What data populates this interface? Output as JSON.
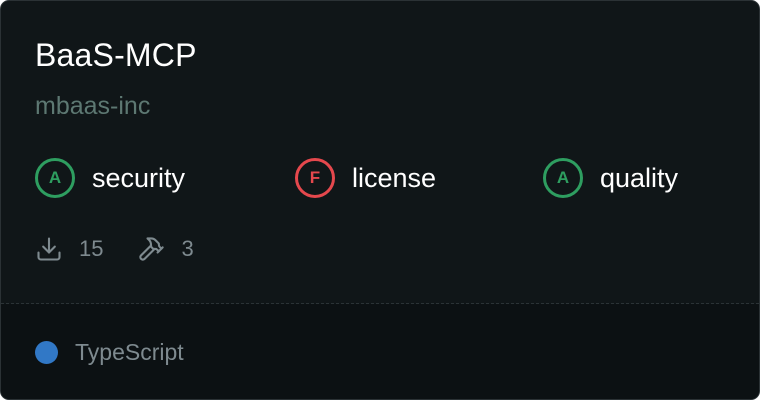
{
  "card": {
    "title": "BaaS-MCP",
    "owner": "mbaas-inc"
  },
  "grades": [
    {
      "letter": "A",
      "label": "security",
      "status": "good"
    },
    {
      "letter": "F",
      "label": "license",
      "status": "bad"
    },
    {
      "letter": "A",
      "label": "quality",
      "status": "good"
    }
  ],
  "stats": {
    "downloads": "15",
    "downloads_icon": "download-icon",
    "tools": "3",
    "tools_icon": "hammer-icon"
  },
  "language": {
    "name": "TypeScript",
    "color": "#3178c6"
  },
  "colors": {
    "good": "#2e9e60",
    "bad": "#e5484d",
    "background": "#101618"
  }
}
